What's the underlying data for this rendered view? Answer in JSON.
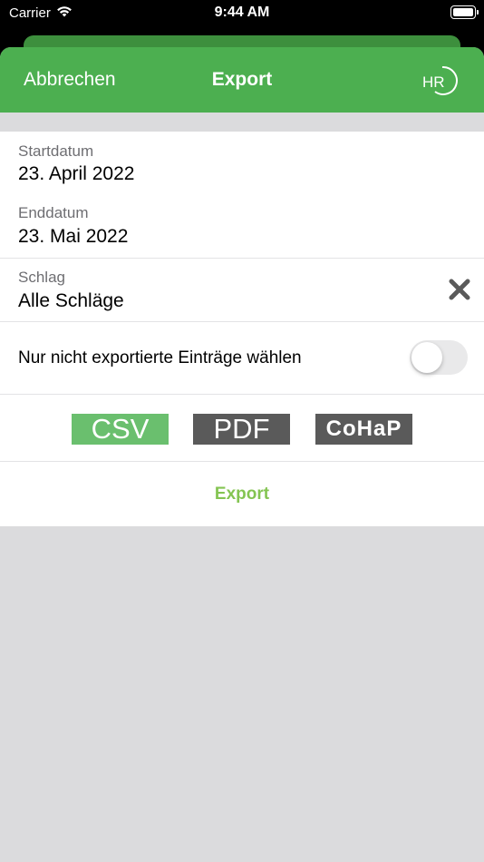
{
  "status_bar": {
    "carrier": "Carrier",
    "time": "9:44 AM",
    "icons": [
      "wifi-icon",
      "battery-icon"
    ]
  },
  "nav": {
    "cancel_label": "Abbrechen",
    "title": "Export",
    "logo_text": "HR",
    "background_color": "#4caf50"
  },
  "form": {
    "start": {
      "label": "Startdatum",
      "value": "23. April 2022"
    },
    "end": {
      "label": "Enddatum",
      "value": "23. Mai 2022"
    },
    "schlag": {
      "label": "Schlag",
      "value": "Alle Schläge",
      "clear_icon": "close-icon"
    },
    "only_unexported": {
      "label": "Nur nicht exportierte Einträge wählen",
      "enabled": false
    },
    "formats": {
      "selected": "CSV",
      "options": [
        "CSV",
        "PDF",
        "CoHaP"
      ],
      "selected_color": "#6abf6e",
      "unselected_color": "#5a5a5a"
    },
    "export_label": "Export",
    "export_color": "#84c452"
  }
}
